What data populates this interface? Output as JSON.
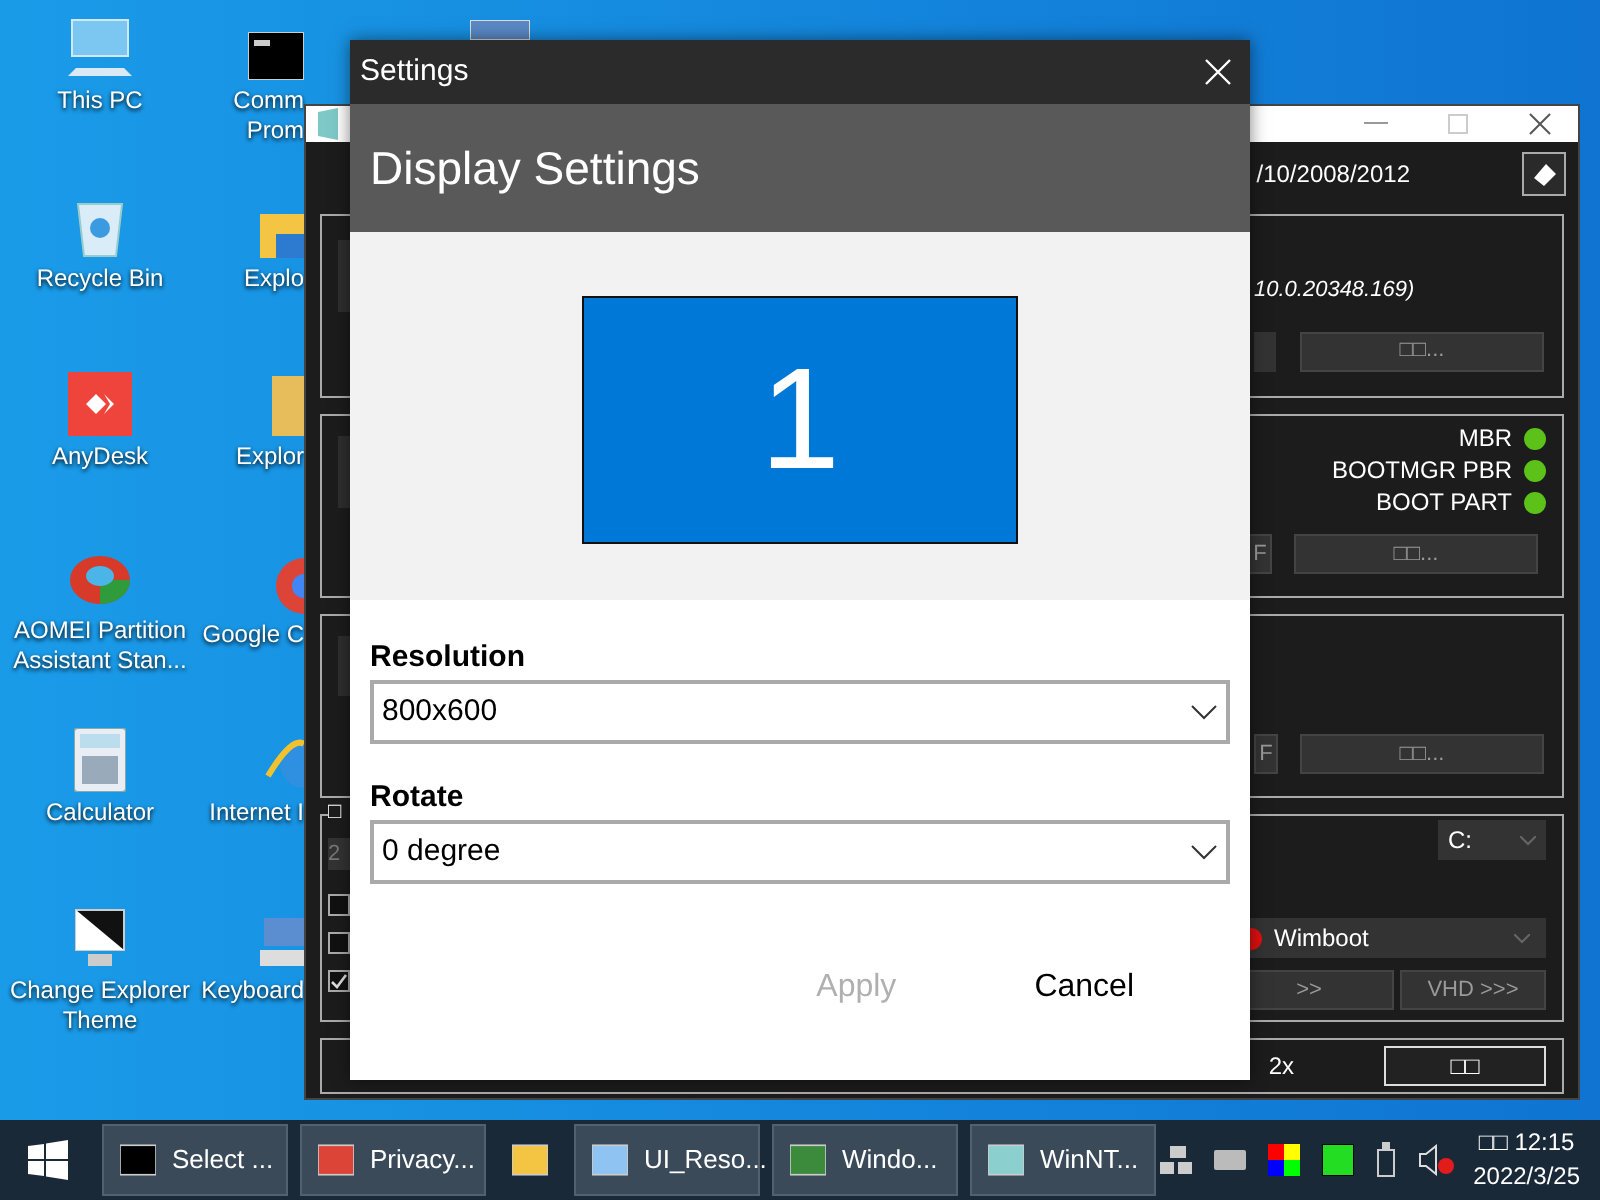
{
  "desktop_icons": [
    {
      "lines": [
        "This PC"
      ]
    },
    {
      "lines": [
        "Recycle Bin"
      ]
    },
    {
      "lines": [
        "AnyDesk"
      ]
    },
    {
      "lines": [
        "AOMEI Partition",
        "Assistant Stan..."
      ]
    },
    {
      "lines": [
        "Calculator"
      ]
    },
    {
      "lines": [
        "Change Explorer",
        "Theme"
      ]
    }
  ],
  "desktop_icons_partial": [
    {
      "lines": [
        "Comm",
        "Prom"
      ]
    },
    {
      "lines": [
        "Explo"
      ]
    },
    {
      "lines": [
        "Explor"
      ]
    },
    {
      "lines": [
        "Google C"
      ]
    },
    {
      "lines": [
        "Internet I"
      ]
    },
    {
      "lines": [
        "Keyboard"
      ]
    }
  ],
  "setup_window": {
    "version_text": "/10/2008/2012",
    "build_text": "10.0.20348.169)",
    "browse_buttons": [
      "□□...",
      "□□...",
      "□□..."
    ],
    "boot_status": [
      {
        "label": "MBR",
        "color": "#5cc21a"
      },
      {
        "label": "BOOTMGR PBR",
        "color": "#5cc21a"
      },
      {
        "label": "BOOT PART",
        "color": "#5cc21a"
      }
    ],
    "f_buttons": [
      "F",
      "F"
    ],
    "option_legend": "□",
    "number_field": "2",
    "checkboxes": [
      {
        "checked": false
      },
      {
        "checked": false
      },
      {
        "checked": true
      }
    ],
    "drive_select": "C:",
    "mode_select": {
      "value": "Wimboot",
      "color": "#e01010"
    },
    "buttons": [
      ">>",
      "VHD >>>"
    ],
    "zoom_label": "2x",
    "action_button": "□□"
  },
  "settings": {
    "title": "Settings",
    "heading": "Display Settings",
    "monitor_label": "1",
    "fields": [
      {
        "label": "Resolution",
        "value": "800x600"
      },
      {
        "label": "Rotate",
        "value": "0 degree"
      }
    ],
    "buttons": [
      {
        "label": "Apply",
        "disabled": true
      },
      {
        "label": "Cancel",
        "disabled": false
      }
    ]
  },
  "taskbar": {
    "items": [
      {
        "label": "Select ...",
        "running": true
      },
      {
        "label": "Privacy...",
        "running": true
      },
      {
        "running": false
      },
      {
        "label": "UI_Reso...",
        "running": true
      },
      {
        "label": "Windo...",
        "running": true
      },
      {
        "label": "WinNT...",
        "running": true
      }
    ],
    "clock": {
      "time": "□□ 12:15",
      "date": "2022/3/25"
    }
  }
}
